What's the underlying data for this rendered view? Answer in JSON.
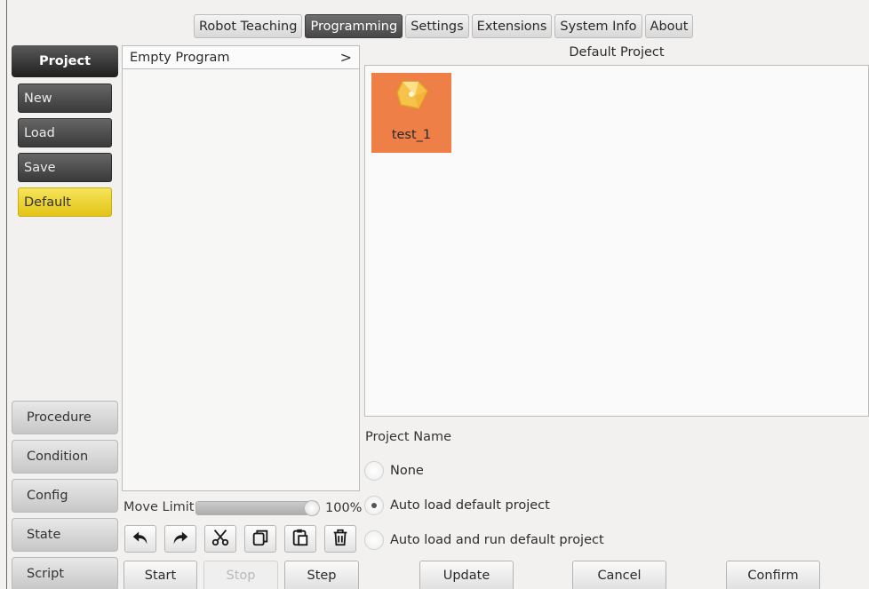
{
  "top_nav": {
    "tabs": [
      {
        "label": "Robot Teaching",
        "active": false
      },
      {
        "label": "Programming",
        "active": true
      },
      {
        "label": "Settings",
        "active": false
      },
      {
        "label": "Extensions",
        "active": false
      },
      {
        "label": "System Info",
        "active": false
      },
      {
        "label": "About",
        "active": false
      }
    ]
  },
  "sidebar": {
    "section_label": "Project",
    "actions": [
      "New",
      "Load",
      "Save",
      "Default"
    ],
    "categories": [
      "Procedure",
      "Condition",
      "Config",
      "State",
      "Script"
    ]
  },
  "program_tree": {
    "header_label": "Empty Program",
    "expand_glyph": ">"
  },
  "move_limit": {
    "label": "Move Limit",
    "value_percent": 100,
    "value_text": "100%"
  },
  "edit_toolbar": {
    "icons": [
      "undo-icon",
      "redo-icon",
      "cut-icon",
      "copy-icon",
      "paste-icon",
      "delete-icon"
    ]
  },
  "run_controls": {
    "start_label": "Start",
    "stop_label": "Stop",
    "step_label": "Step"
  },
  "default_project": {
    "title": "Default Project",
    "projects": [
      {
        "name": "test_1",
        "icon": "project-file-icon"
      }
    ]
  },
  "startup_options": {
    "label": "Project Name",
    "options": [
      {
        "label": "None",
        "selected": false
      },
      {
        "label": "Auto load default project",
        "selected": true
      },
      {
        "label": "Auto load and run default project",
        "selected": false
      }
    ]
  },
  "footer": {
    "update_label": "Update",
    "cancel_label": "Cancel",
    "confirm_label": "Confirm"
  },
  "colors": {
    "active_tab": "#474747",
    "default_button": "#e2c516",
    "project_tile": "#ee7f47"
  }
}
